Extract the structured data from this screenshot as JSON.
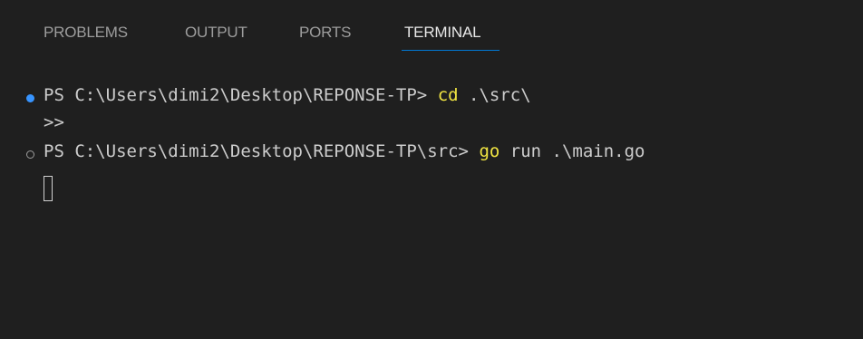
{
  "tabs": [
    {
      "label": "PROBLEMS"
    },
    {
      "label": "OUTPUT"
    },
    {
      "label": "PORTS"
    },
    {
      "label": "TERMINAL"
    }
  ],
  "active_tab": "TERMINAL",
  "terminal": {
    "line1": {
      "prompt": "PS C:\\Users\\dimi2\\Desktop\\REPONSE-TP> ",
      "command": "cd",
      "args": " .\\src\\"
    },
    "line2": {
      "text": ">>"
    },
    "line3": {
      "prompt": "PS C:\\Users\\dimi2\\Desktop\\REPONSE-TP\\src> ",
      "command": "go",
      "args": " run .\\main.go"
    }
  },
  "colors": {
    "background": "#1f1f1f",
    "command": "#f0e442",
    "accent": "#0078d4",
    "success_dot": "#3794ff"
  }
}
